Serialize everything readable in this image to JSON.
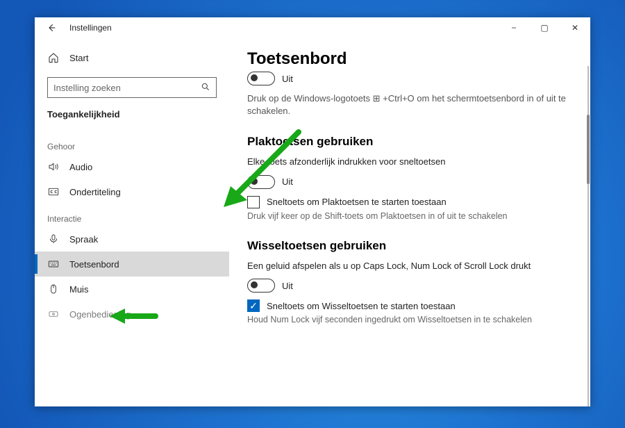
{
  "window": {
    "title": "Instellingen",
    "controls": {
      "minimize": "−",
      "maximize": "▢",
      "close": "✕"
    }
  },
  "sidebar": {
    "home": "Start",
    "search_placeholder": "Instelling zoeken",
    "breadcrumb": "Toegankelijkheid",
    "groups": [
      {
        "label": "Gehoor",
        "items": [
          {
            "icon": "speaker-icon",
            "label": "Audio"
          },
          {
            "icon": "cc-icon",
            "label": "Ondertiteling"
          }
        ]
      },
      {
        "label": "Interactie",
        "items": [
          {
            "icon": "microphone-icon",
            "label": "Spraak"
          },
          {
            "icon": "keyboard-icon",
            "label": "Toetsenbord",
            "selected": true
          },
          {
            "icon": "mouse-icon",
            "label": "Muis"
          },
          {
            "icon": "eye-icon",
            "label": "Ogenbediening"
          }
        ]
      }
    ]
  },
  "main": {
    "page_title": "Toetsenbord",
    "top_toggle_state": "Uit",
    "top_hint": "Druk op de Windows-logotoets ⊞ +Ctrl+O om het schermtoetsenbord in of uit te schakelen.",
    "sections": [
      {
        "title": "Plaktoetsen gebruiken",
        "lead": "Elke toets afzonderlijk indrukken voor sneltoetsen",
        "toggle_state": "Uit",
        "checkbox_checked": false,
        "checkbox_label": "Sneltoets om Plaktoetsen te starten toestaan",
        "hint": "Druk vijf keer op de Shift-toets om Plaktoetsen in of uit te schakelen"
      },
      {
        "title": "Wisseltoetsen gebruiken",
        "lead": "Een geluid afspelen als u op Caps Lock, Num Lock of Scroll Lock drukt",
        "toggle_state": "Uit",
        "checkbox_checked": true,
        "checkbox_label": "Sneltoets om Wisseltoetsen te starten toestaan",
        "hint": "Houd Num Lock vijf seconden ingedrukt om Wisseltoetsen in te schakelen"
      }
    ]
  },
  "annotations": {
    "arrows": [
      {
        "target": "sidebar-item-toetsenbord",
        "color": "#18a818"
      },
      {
        "target": "checkbox-plaktoetsen-sneltoets",
        "color": "#18a818"
      }
    ]
  }
}
